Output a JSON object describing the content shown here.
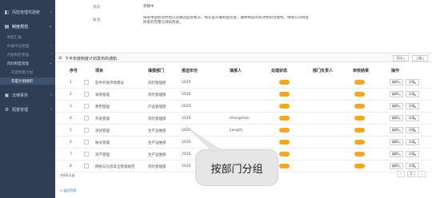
{
  "sidebar": {
    "items": [
      {
        "label": "风险管理驾驶舱",
        "icon": "dashboard-icon"
      },
      {
        "label": "制度规范",
        "icon": "document-icon"
      },
      {
        "label": "法律事务",
        "icon": "briefcase-icon"
      },
      {
        "label": "配置管理",
        "icon": "gear-icon"
      }
    ],
    "subitems": [
      "制度汇编",
      "外规内化管理",
      "内规制定管理",
      "风险制度管理"
    ],
    "l2items": [
      "年度制度计划",
      "年度计划组织"
    ]
  },
  "form": {
    "status_label": "状态:",
    "status_value": "草稿中",
    "remark_label": "备注:",
    "remark_value": "按照中国移动党组以及集团监管要求，每年度开展制度检查，确保制度的有效性和合规性，保障公司制度体系的完整与持续改进。"
  },
  "section": {
    "title": "下半年度制度计划发布的通知",
    "btn_export": "导出",
    "btn_back": "上级"
  },
  "table": {
    "headers": [
      "序号",
      "项目",
      "填报部门",
      "报送年份",
      "填报人",
      "处理状态",
      "部门负责人",
      "审核结果",
      "操作"
    ],
    "rows": [
      {
        "no": "1",
        "item": "软件开发项目建设",
        "dept": "风险管理部",
        "year": "2020",
        "user": ""
      },
      {
        "no": "2",
        "item": "采购管理",
        "dept": "风险管理部",
        "year": "2020",
        "user": ""
      },
      {
        "no": "3",
        "item": "费用管理",
        "dept": "产品管理部",
        "year": "2020",
        "user": ""
      },
      {
        "no": "4",
        "item": "开发管理",
        "dept": "风险管理部",
        "year": "2020",
        "user": "zhangchen"
      },
      {
        "no": "5",
        "item": "测试管理",
        "dept": "生产运维部",
        "year": "2020",
        "user": "jiangzh"
      },
      {
        "no": "6",
        "item": "账号管理",
        "dept": "生产运维部",
        "year": "2020",
        "user": ""
      },
      {
        "no": "7",
        "item": "资产管理",
        "dept": "生产运维部",
        "year": "2020",
        "user": ""
      },
      {
        "no": "8",
        "item": "网络与信息安全管理规范",
        "dept": "风险管理部",
        "year": "2020",
        "user": ""
      }
    ],
    "action_edit": "编辑",
    "action_view": "详情"
  },
  "pager": {
    "total": "共8条记录",
    "page": "1"
  },
  "footer": {
    "link": "返回列表"
  },
  "callout": {
    "text": "按部门分组"
  },
  "colors": {
    "sidebar_bg": "#2f3d55",
    "status_badge": "#f5a623",
    "callout_bg": "#e6e6e6"
  }
}
